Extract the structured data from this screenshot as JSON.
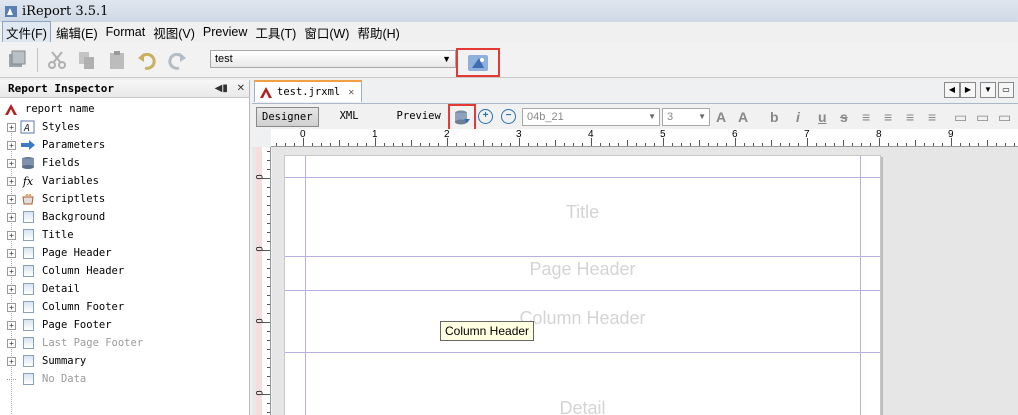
{
  "app": {
    "title": "iReport 3.5.1"
  },
  "menu": [
    "文件(F)",
    "编辑(E)",
    "Format",
    "视图(V)",
    "Preview",
    "工具(T)",
    "窗口(W)",
    "帮助(H)"
  ],
  "toolbar": {
    "connection_value": "test"
  },
  "inspector": {
    "title": "Report Inspector",
    "items": [
      {
        "label": "report name",
        "icon": "report-icon",
        "expandable": false,
        "root": true
      },
      {
        "label": "Styles",
        "icon": "styles-icon",
        "expandable": true
      },
      {
        "label": "Parameters",
        "icon": "parameters-icon",
        "expandable": true
      },
      {
        "label": "Fields",
        "icon": "fields-icon",
        "expandable": true
      },
      {
        "label": "Variables",
        "icon": "variables-icon",
        "expandable": true
      },
      {
        "label": "Scriptlets",
        "icon": "scriptlets-icon",
        "expandable": true
      },
      {
        "label": "Background",
        "icon": "band-icon",
        "expandable": true
      },
      {
        "label": "Title",
        "icon": "band-icon",
        "expandable": true
      },
      {
        "label": "Page Header",
        "icon": "band-icon",
        "expandable": true
      },
      {
        "label": "Column Header",
        "icon": "band-icon",
        "expandable": true
      },
      {
        "label": "Detail",
        "icon": "band-icon",
        "expandable": true
      },
      {
        "label": "Column Footer",
        "icon": "band-icon",
        "expandable": true
      },
      {
        "label": "Page Footer",
        "icon": "band-icon",
        "expandable": true
      },
      {
        "label": "Last Page Footer",
        "icon": "band-icon",
        "expandable": true,
        "disabled": true
      },
      {
        "label": "Summary",
        "icon": "band-icon",
        "expandable": true
      },
      {
        "label": "No Data",
        "icon": "band-icon",
        "expandable": false,
        "disabled": true
      }
    ]
  },
  "editor": {
    "tab_label": "test.jrxml",
    "views": {
      "designer": "Designer",
      "xml": "XML",
      "preview": "Preview"
    },
    "font_name": "04b_21",
    "font_size": "3",
    "ruler_numbers": [
      "0",
      "1",
      "2",
      "3",
      "4",
      "5",
      "6",
      "7",
      "8",
      "9"
    ],
    "bands": {
      "title": "Title",
      "page_header": "Page Header",
      "column_header": "Column Header",
      "detail": "Detail"
    },
    "tooltip": "Column Header"
  }
}
